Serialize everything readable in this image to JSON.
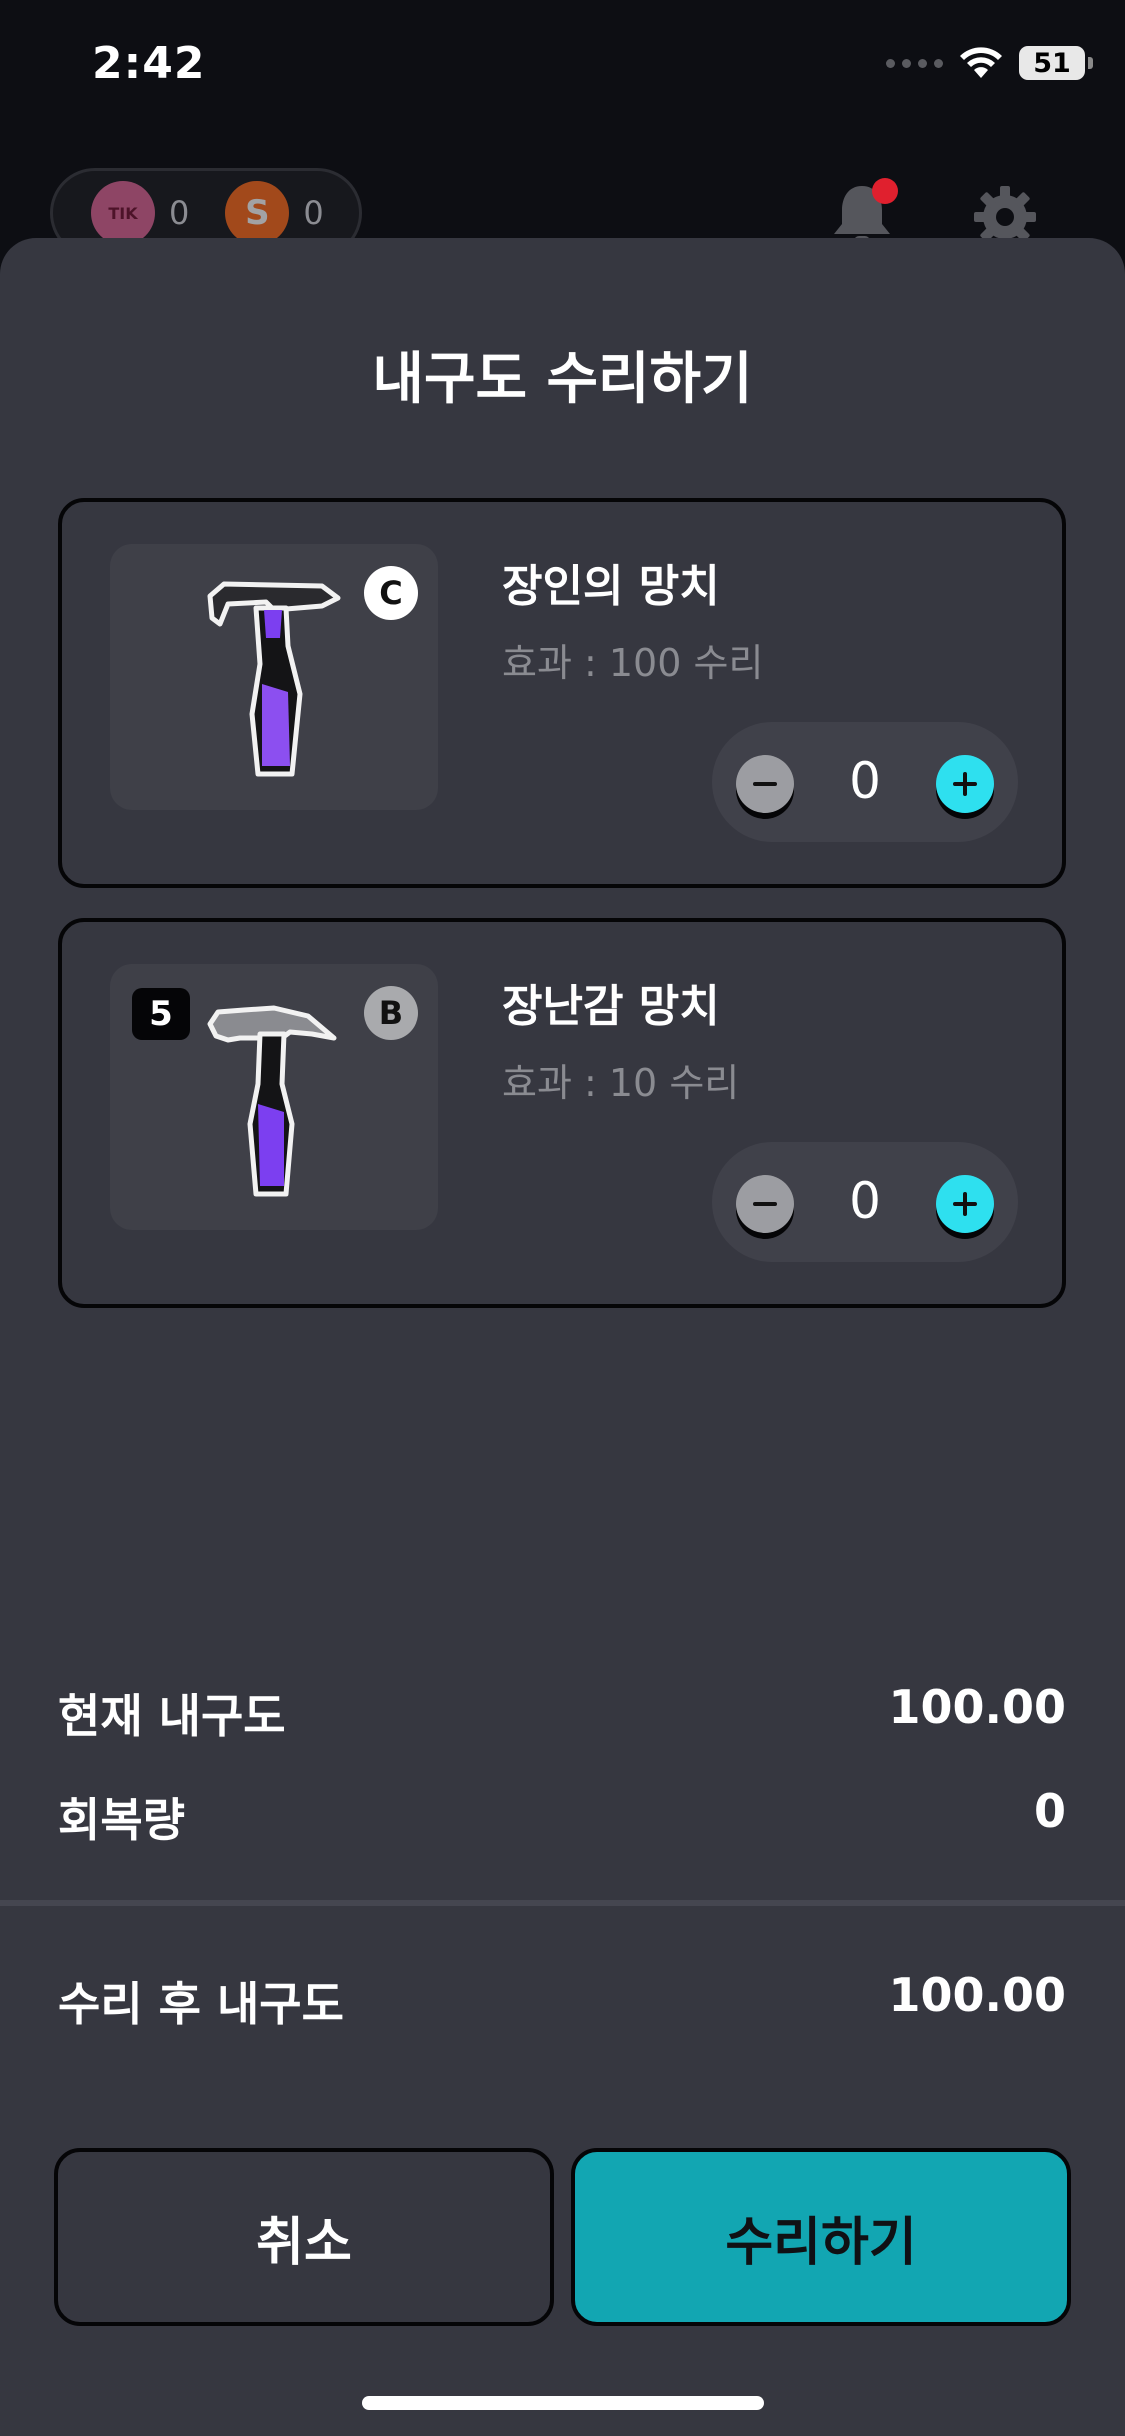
{
  "status_bar": {
    "time": "2:42",
    "battery": "51",
    "icons": [
      "signal-icon",
      "wifi-icon",
      "battery-icon"
    ]
  },
  "header": {
    "currencies": [
      {
        "name": "tik-coin-icon",
        "count": "0"
      },
      {
        "name": "s-coin-icon",
        "count": "0"
      }
    ],
    "icons": [
      "bell-icon",
      "gear-icon"
    ]
  },
  "sheet": {
    "title": "내구도 수리하기",
    "items": [
      {
        "name": "장인의 망치",
        "effect": "효과 : 100 수리",
        "grade": "C",
        "count": "",
        "quantity": "0",
        "icon": "hammer-icon"
      },
      {
        "name": "장난감 망치",
        "effect": "효과 : 10 수리",
        "grade": "B",
        "count": "5",
        "quantity": "0",
        "icon": "hammer-icon"
      }
    ],
    "summary": {
      "current_label": "현재 내구도",
      "current_value": "100.00",
      "recovery_label": "회복량",
      "recovery_value": "0",
      "after_label": "수리 후 내구도",
      "after_value": "100.00"
    },
    "buttons": {
      "cancel": "취소",
      "repair": "수리하기"
    }
  },
  "colors": {
    "accent": "#12a6b2",
    "plus": "#2ee0ef",
    "sheet_bg": "#363740",
    "notification": "#e0202e"
  }
}
